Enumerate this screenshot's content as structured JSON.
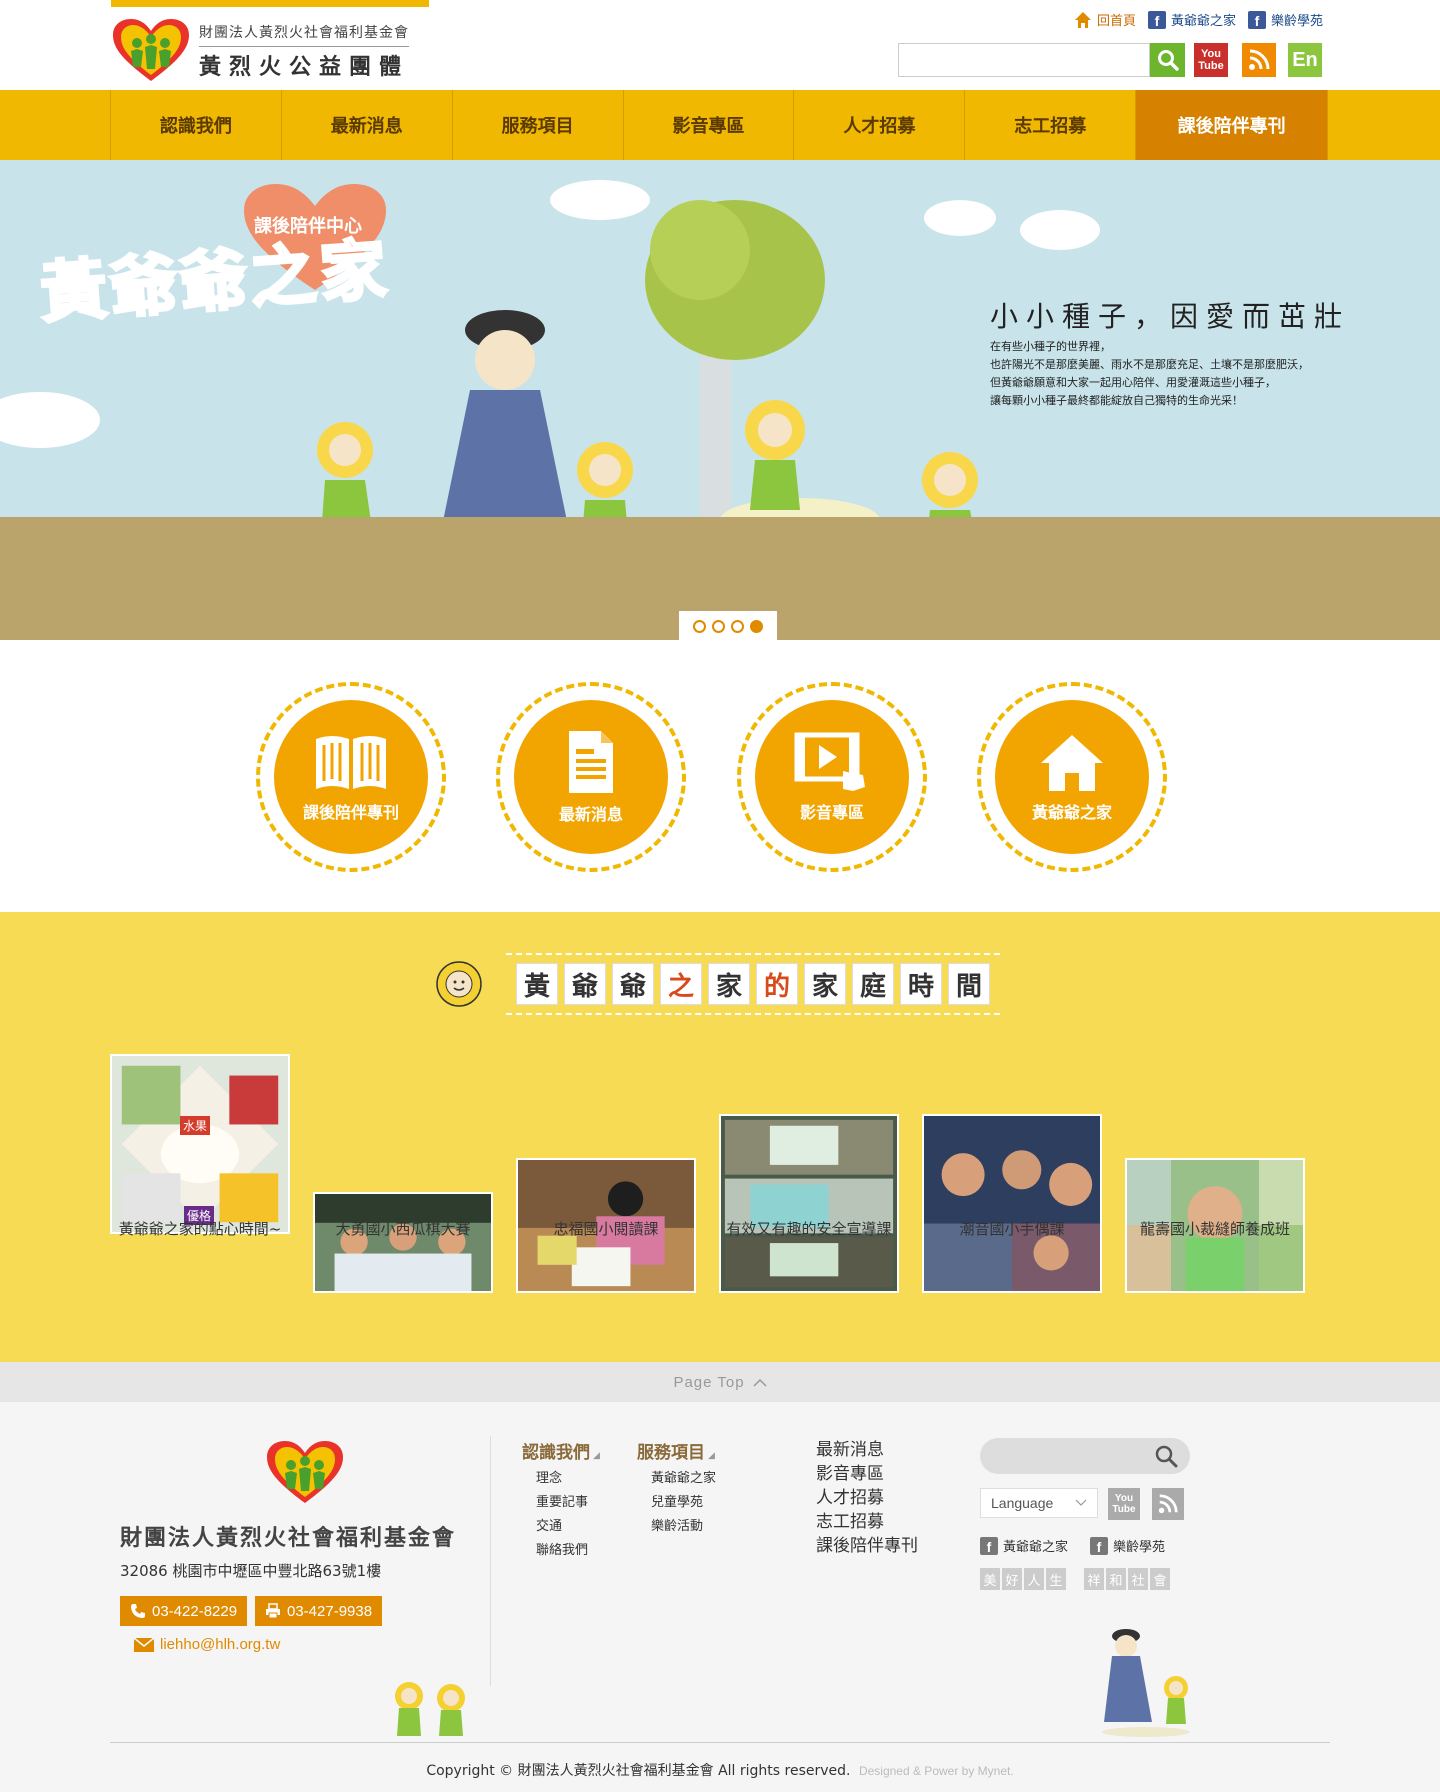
{
  "header": {
    "logo_line1": "財團法人黃烈火社會福利基金會",
    "logo_line2": "黃烈火公益團體",
    "home_link": "回首頁",
    "fb_link1": "黃爺爺之家",
    "fb_link2": "樂齡學苑",
    "search_placeholder": "",
    "youtube_label": "You Tube",
    "en_label": "En"
  },
  "nav": {
    "items": [
      {
        "label": "認識我們"
      },
      {
        "label": "最新消息"
      },
      {
        "label": "服務項目"
      },
      {
        "label": "影音專區"
      },
      {
        "label": "人才招募"
      },
      {
        "label": "志工招募"
      },
      {
        "label": "課後陪伴專刊"
      }
    ],
    "active_index": 6
  },
  "banner": {
    "sub_title": "課後陪伴中心",
    "title": "黃爺爺之家",
    "slogan": "小小種子，因愛而茁壯",
    "text_lines": [
      "在有些小種子的世界裡，",
      "也許陽光不是那麼美麗、雨水不是那麼充足、土壤不是那麼肥沃，",
      "但黃爺爺願意和大家一起用心陪伴、用愛灌溉這些小種子，",
      "讓每顆小小種子最終都能綻放自己獨特的生命光采！"
    ],
    "slide_count": 4,
    "active_slide": 4
  },
  "quick_links": [
    {
      "label": "課後陪伴專刊",
      "icon": "book-icon"
    },
    {
      "label": "最新消息",
      "icon": "document-icon"
    },
    {
      "label": "影音專區",
      "icon": "video-icon"
    },
    {
      "label": "黃爺爺之家",
      "icon": "house-icon"
    }
  ],
  "family": {
    "title_chars": [
      "黃",
      "爺",
      "爺",
      "之",
      "家",
      "的",
      "家",
      "庭",
      "時",
      "間"
    ],
    "red_indices": [
      3,
      5
    ],
    "items": [
      {
        "caption": "黃爺爺之家的點心時間~",
        "inner_labels": [
          "水果",
          "優格"
        ]
      },
      {
        "caption": "大勇國小西瓜棋大賽"
      },
      {
        "caption": "忠福國小閱讀課"
      },
      {
        "caption": "有效又有趣的安全宣導課"
      },
      {
        "caption": "潮音國小手偶課"
      },
      {
        "caption": "龍壽國小裁縫師養成班"
      }
    ]
  },
  "page_top": "Page Top",
  "footer": {
    "org_name": "財團法人黃烈火社會福利基金會",
    "address": "32086 桃園市中壢區中豐北路63號1樓",
    "tel": "03-422-8229",
    "fax": "03-427-9938",
    "email": "liehho@hlh.org.tw",
    "col1": {
      "title": "認識我們",
      "items": [
        "理念",
        "重要記事",
        "交通",
        "聯絡我們"
      ]
    },
    "col2": {
      "title": "服務項目",
      "items": [
        "黃爺爺之家",
        "兒童學苑",
        "樂齡活動"
      ]
    },
    "col3": {
      "items": [
        "最新消息",
        "影音專區",
        "人才招募",
        "志工招募",
        "課後陪伴專刊"
      ]
    },
    "language_label": "Language",
    "fb_link1": "黃爺爺之家",
    "fb_link2": "樂齡學苑",
    "tag1": [
      "美",
      "好",
      "人",
      "生"
    ],
    "tag2": [
      "祥",
      "和",
      "社",
      "會"
    ],
    "copyright": "Copyright © 財團法人黃烈火社會福利基金會 All rights reserved.",
    "powered": "Designed & Power by Mynet."
  },
  "colors": {
    "brand_yellow": "#f0b800",
    "brand_orange": "#d68100",
    "family_bg": "#f8db55"
  }
}
